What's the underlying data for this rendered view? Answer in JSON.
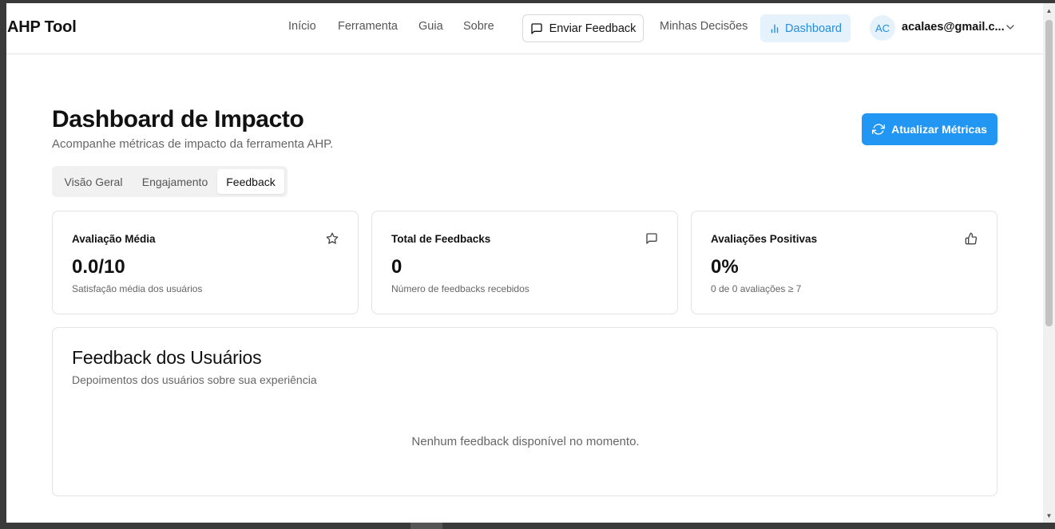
{
  "header": {
    "brand": "AHP Tool",
    "nav": [
      {
        "label": "Início"
      },
      {
        "label": "Ferramenta"
      },
      {
        "label": "Guia"
      },
      {
        "label": "Sobre"
      }
    ],
    "feedback_button": {
      "label": "Enviar Feedback",
      "icon": "message-square-icon"
    },
    "decisions_link": "Minhas Decisões",
    "dashboard_button": {
      "label": "Dashboard",
      "icon": "bar-chart-icon"
    },
    "user": {
      "initials": "AC",
      "email": "acalaes@gmail.c...",
      "icon": "chevron-down-icon"
    }
  },
  "main": {
    "title": "Dashboard de Impacto",
    "subtitle": "Acompanhe métricas de impacto da ferramenta AHP.",
    "refresh_button": {
      "label": "Atualizar Métricas",
      "icon": "refresh-icon"
    },
    "tabs": [
      {
        "label": "Visão Geral",
        "active": false
      },
      {
        "label": "Engajamento",
        "active": false
      },
      {
        "label": "Feedback",
        "active": true
      }
    ],
    "cards": [
      {
        "title": "Avaliação Média",
        "value": "0.0/10",
        "description": "Satisfação média dos usuários",
        "icon": "star-icon"
      },
      {
        "title": "Total de Feedbacks",
        "value": "0",
        "description": "Número de feedbacks recebidos",
        "icon": "message-square-icon"
      },
      {
        "title": "Avaliações Positivas",
        "value": "0%",
        "description": "0 de 0 avaliações ≥ 7",
        "icon": "thumbs-up-icon"
      }
    ],
    "feedback_panel": {
      "title": "Feedback dos Usuários",
      "subtitle": "Depoimentos dos usuários sobre sua experiência",
      "empty_message": "Nenhum feedback disponível no momento."
    }
  },
  "colors": {
    "accent": "#2196f3",
    "accent_light": "#e5f2fc",
    "accent_text": "#1f8ee6",
    "border": "#e3e3e3"
  }
}
